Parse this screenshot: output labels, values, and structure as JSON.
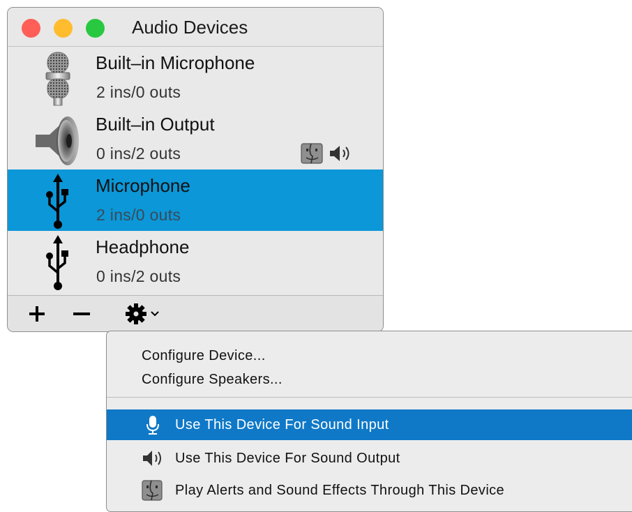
{
  "window": {
    "title": "Audio Devices"
  },
  "devices": [
    {
      "name": "Built–in Microphone",
      "io": "2 ins/0 outs",
      "icon": "microphone-icon",
      "selected": false
    },
    {
      "name": "Built–in Output",
      "io": "0 ins/2 outs",
      "icon": "speaker-icon",
      "selected": false,
      "badges": [
        "finder-icon",
        "speaker-volume-icon"
      ]
    },
    {
      "name": "Microphone",
      "io": "2 ins/0 outs",
      "icon": "usb-icon",
      "selected": true
    },
    {
      "name": "Headphone",
      "io": "0 ins/2 outs",
      "icon": "usb-icon",
      "selected": false
    }
  ],
  "toolbar": {
    "add_icon": "plus-icon",
    "remove_icon": "minus-icon",
    "actions_icon": "gear-icon"
  },
  "menu": {
    "items": [
      {
        "label": "Configure Device..."
      },
      {
        "label": "Configure Speakers..."
      },
      {
        "label": "Use This Device For Sound Input",
        "icon": "microphone-icon",
        "highlighted": true
      },
      {
        "label": "Use This Device For Sound Output",
        "icon": "speaker-volume-icon"
      },
      {
        "label": "Play Alerts and Sound Effects Through This Device",
        "icon": "finder-icon"
      }
    ]
  },
  "colors": {
    "selection": "#0b97d8",
    "menu_highlight": "#0f79c8",
    "close": "#ff5f57",
    "minimize": "#febc2e",
    "zoom": "#28c840"
  }
}
